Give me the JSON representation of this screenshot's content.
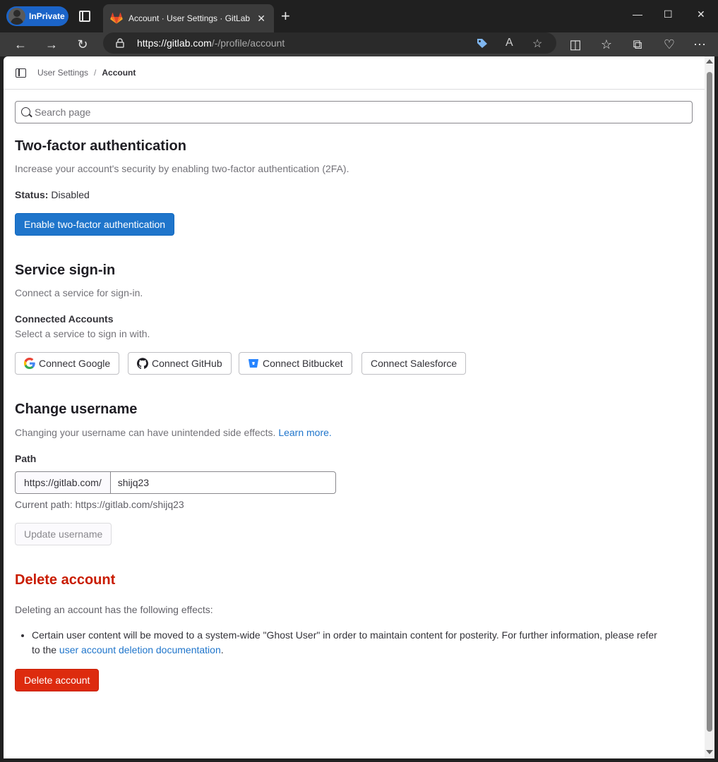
{
  "browser": {
    "inprivate_label": "InPrivate",
    "tab_title": "Account · User Settings · GitLab",
    "tab_close": "✕",
    "new_tab": "+",
    "url_host": "https://gitlab.com",
    "url_path": "/-/profile/account",
    "window_controls": {
      "minimize": "—",
      "maximize": "☐",
      "close": "✕"
    }
  },
  "breadcrumb": {
    "parent": "User Settings",
    "separator": "/",
    "current": "Account"
  },
  "search": {
    "placeholder": "Search page"
  },
  "two_factor": {
    "title": "Two-factor authentication",
    "description": "Increase your account's security by enabling two-factor authentication (2FA).",
    "status_label": "Status:",
    "status_value": "Disabled",
    "enable_button": "Enable two-factor authentication"
  },
  "service_signin": {
    "title": "Service sign-in",
    "description": "Connect a service for sign-in.",
    "connected_title": "Connected Accounts",
    "connected_description": "Select a service to sign in with.",
    "buttons": {
      "google": "Connect Google",
      "github": "Connect GitHub",
      "bitbucket": "Connect Bitbucket",
      "salesforce": "Connect Salesforce"
    }
  },
  "change_username": {
    "title": "Change username",
    "description": "Changing your username can have unintended side effects.",
    "learn_more": "Learn more.",
    "path_label": "Path",
    "path_prefix": "https://gitlab.com/",
    "username": "shijq23",
    "current_path": "Current path: https://gitlab.com/shijq23",
    "update_button": "Update username"
  },
  "delete_account": {
    "title": "Delete account",
    "intro": "Deleting an account has the following effects:",
    "effect_text": "Certain user content will be moved to a system-wide \"Ghost User\" in order to maintain content for posterity. For further information, please refer to the",
    "effect_link": "user account deletion documentation",
    "effect_end": ".",
    "button": "Delete account"
  },
  "colors": {
    "primary": "#1f75cb",
    "danger": "#dd2b0e",
    "danger_text": "#c91c00"
  }
}
